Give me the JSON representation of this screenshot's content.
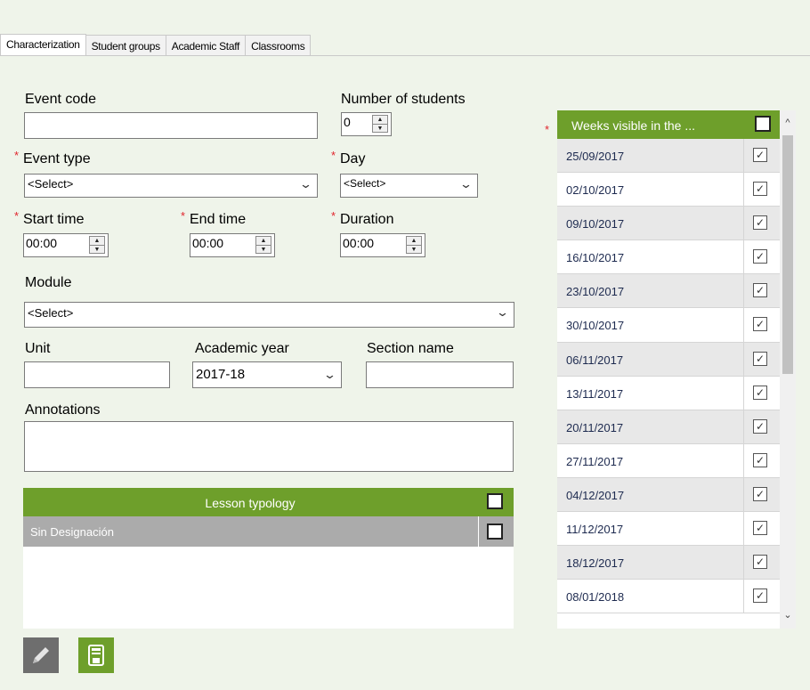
{
  "tabs": [
    "Characterization",
    "Student groups",
    "Academic Staff",
    "Classrooms"
  ],
  "form": {
    "event_code_label": "Event code",
    "event_code_value": "",
    "num_students_label": "Number of students",
    "num_students_value": "0",
    "event_type_label": "Event type",
    "event_type_value": "<Select>",
    "day_label": "Day",
    "day_value": "<Select>",
    "start_time_label": "Start time",
    "start_time_value": "00:00",
    "end_time_label": "End time",
    "end_time_value": "00:00",
    "duration_label": "Duration",
    "duration_value": "00:00",
    "module_label": "Module",
    "module_value": "<Select>",
    "unit_label": "Unit",
    "unit_value": "",
    "academic_year_label": "Academic year",
    "academic_year_value": "2017-18",
    "section_name_label": "Section name",
    "section_name_value": "",
    "annotations_label": "Annotations",
    "annotations_value": ""
  },
  "lesson_typology": {
    "header": "Lesson typology",
    "rows": [
      {
        "label": "Sin Designación",
        "checked": false
      }
    ]
  },
  "weeks": {
    "header": "Weeks visible in the ...",
    "rows": [
      {
        "date": "25/09/2017",
        "checked": true
      },
      {
        "date": "02/10/2017",
        "checked": true
      },
      {
        "date": "09/10/2017",
        "checked": true
      },
      {
        "date": "16/10/2017",
        "checked": true
      },
      {
        "date": "23/10/2017",
        "checked": true
      },
      {
        "date": "30/10/2017",
        "checked": true
      },
      {
        "date": "06/11/2017",
        "checked": true
      },
      {
        "date": "13/11/2017",
        "checked": true
      },
      {
        "date": "20/11/2017",
        "checked": true
      },
      {
        "date": "27/11/2017",
        "checked": true
      },
      {
        "date": "04/12/2017",
        "checked": true
      },
      {
        "date": "11/12/2017",
        "checked": true
      },
      {
        "date": "18/12/2017",
        "checked": true
      },
      {
        "date": "08/01/2018",
        "checked": true
      }
    ]
  },
  "colors": {
    "accent": "#6e9f2b",
    "required": "#e0242c",
    "background": "#eff4ea"
  },
  "icons": {
    "edit": "pencil-icon",
    "save": "floppy-disk-icon"
  }
}
